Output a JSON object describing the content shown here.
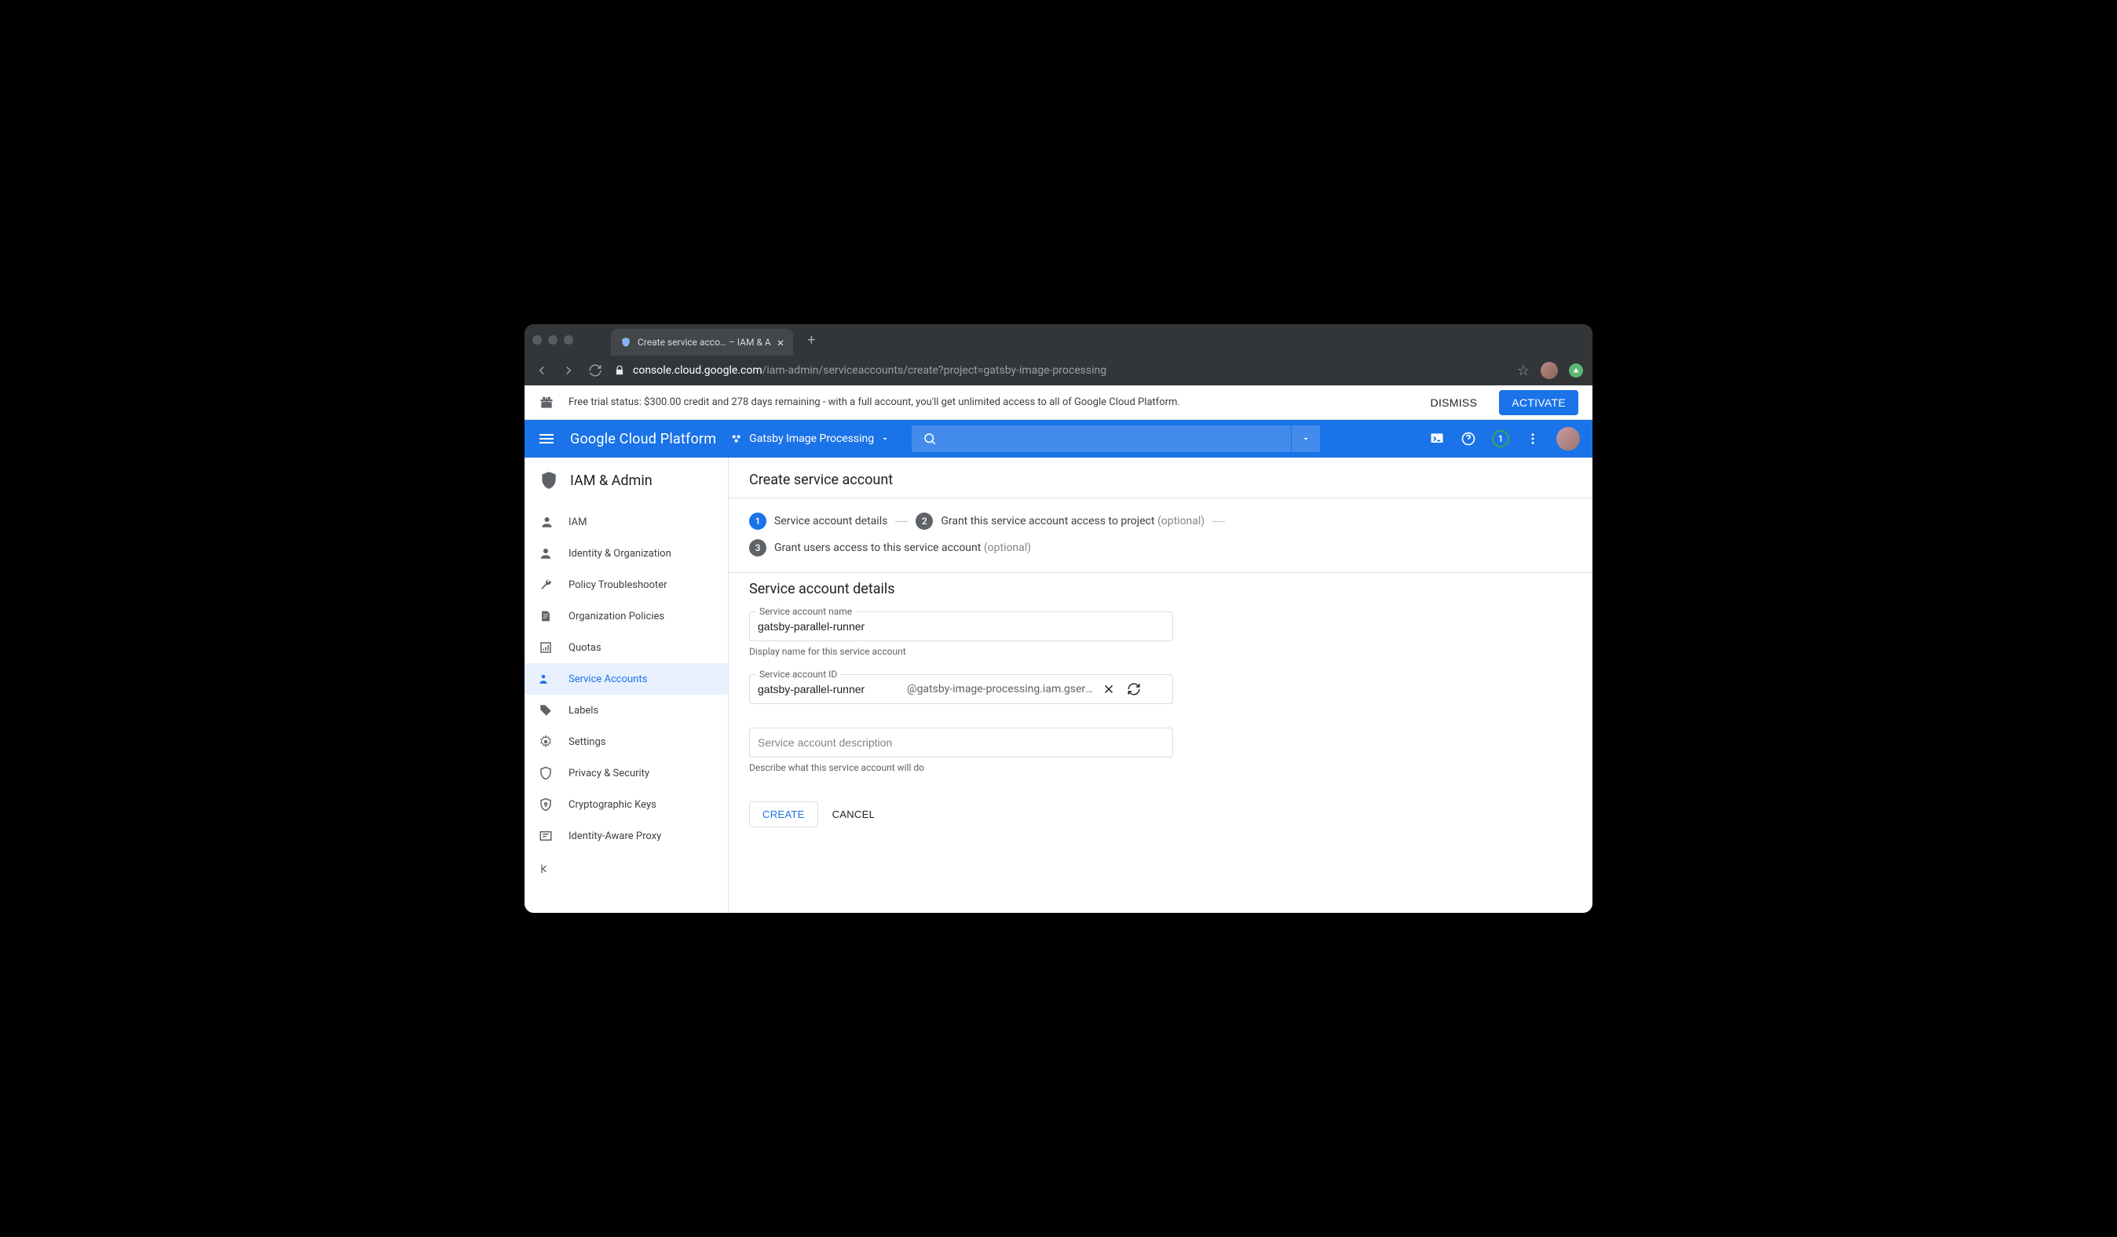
{
  "browser": {
    "tab_title": "Create service acco… – IAM & A",
    "url_host": "console.cloud.google.com",
    "url_path": "/iam-admin/serviceaccounts/create?project=gatsby-image-processing"
  },
  "trial_bar": {
    "text": "Free trial status: $300.00 credit and 278 days remaining - with a full account, you'll get unlimited access to all of Google Cloud Platform.",
    "dismiss": "DISMISS",
    "activate": "ACTIVATE"
  },
  "topbar": {
    "product": "Google Cloud Platform",
    "project": "Gatsby Image Processing",
    "notifications": "1"
  },
  "sidebar": {
    "section": "IAM & Admin",
    "items": [
      {
        "label": "IAM"
      },
      {
        "label": "Identity & Organization"
      },
      {
        "label": "Policy Troubleshooter"
      },
      {
        "label": "Organization Policies"
      },
      {
        "label": "Quotas"
      },
      {
        "label": "Service Accounts"
      },
      {
        "label": "Labels"
      },
      {
        "label": "Settings"
      },
      {
        "label": "Privacy & Security"
      },
      {
        "label": "Cryptographic Keys"
      },
      {
        "label": "Identity-Aware Proxy"
      }
    ]
  },
  "main": {
    "title": "Create service account",
    "stepper": {
      "step1": "Service account details",
      "step2": "Grant this service account access to project",
      "step3": "Grant users access to this service account",
      "optional": "(optional)"
    },
    "section_title": "Service account details",
    "name_field": {
      "label": "Service account name",
      "value": "gatsby-parallel-runner",
      "hint": "Display name for this service account"
    },
    "id_field": {
      "label": "Service account ID",
      "value": "gatsby-parallel-runner",
      "suffix": "@gatsby-image-processing.iam.gservicea"
    },
    "desc_field": {
      "placeholder": "Service account description",
      "hint": "Describe what this service account will do"
    },
    "create": "CREATE",
    "cancel": "CANCEL"
  }
}
